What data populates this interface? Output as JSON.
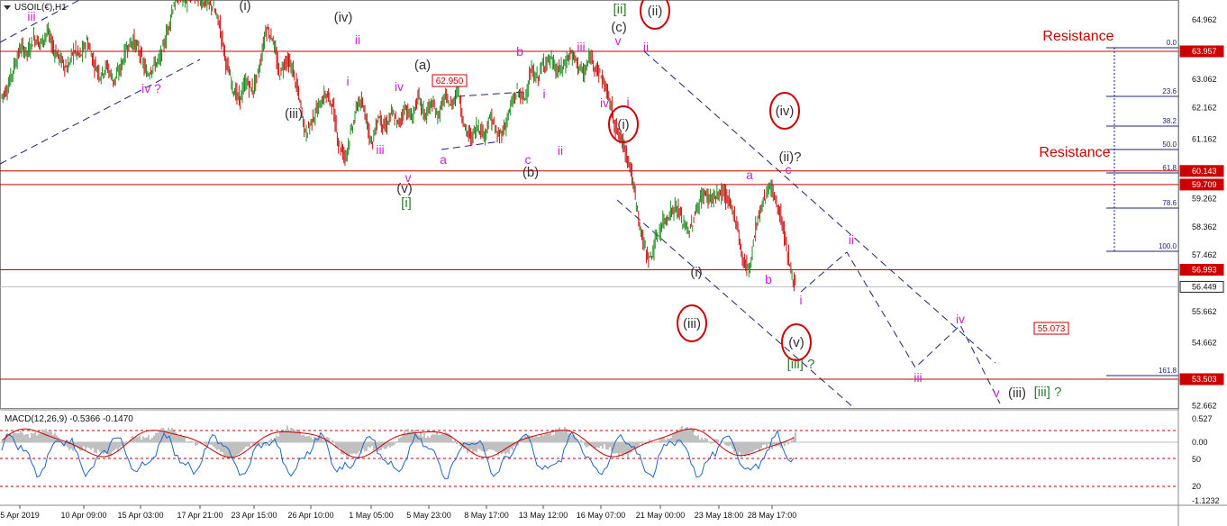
{
  "chart_data": [
    {
      "type": "line",
      "title": "USOIL(€),H1",
      "ylim": [
        52.3,
        65.6
      ],
      "y_ticks": [
        64.962,
        63.957,
        63.062,
        62.162,
        61.162,
        60.143,
        59.709,
        59.262,
        58.362,
        57.462,
        56.993,
        56.449,
        55.662,
        54.662,
        53.503,
        52.662
      ],
      "price_labels": [
        {
          "value": 63.957,
          "label": "63.957",
          "highlight": true
        },
        {
          "value": 60.143,
          "label": "60.143",
          "highlight": true
        },
        {
          "value": 59.709,
          "label": "59.709",
          "highlight": true
        },
        {
          "value": 56.993,
          "label": "56.993",
          "highlight": true
        },
        {
          "value": 53.503,
          "label": "53.503",
          "highlight": true
        },
        {
          "value": 56.449,
          "label": "56.449",
          "highlight": false
        }
      ],
      "tick_labels": [
        {
          "label": "64.962",
          "value": 64.962
        },
        {
          "label": "63.062",
          "value": 63.062
        },
        {
          "label": "62.162",
          "value": 62.162
        },
        {
          "label": "61.162",
          "value": 61.162
        },
        {
          "label": "59.262",
          "value": 59.262
        },
        {
          "label": "58.362",
          "value": 58.362
        },
        {
          "label": "57.462",
          "value": 57.462
        },
        {
          "label": "55.662",
          "value": 55.662
        },
        {
          "label": "54.662",
          "value": 54.662
        },
        {
          "label": "52.662",
          "value": 52.662
        }
      ],
      "horizontal_lines": [
        63.957,
        60.143,
        59.709,
        56.993,
        53.503
      ],
      "current_price": 56.449,
      "series": [
        {
          "values": [
            62.5,
            62.8,
            63.5,
            64.1,
            63.9,
            64.4,
            64.2,
            64.6,
            64.0,
            63.7,
            63.4,
            64.0,
            63.8,
            64.3,
            63.6,
            63.2,
            63.5,
            63.0,
            63.4,
            64.1,
            64.3,
            63.9,
            63.2,
            63.5,
            63.7,
            64.5,
            65.4,
            65.8,
            65.5,
            65.8,
            65.6,
            65.5,
            65.4,
            64.8,
            63.6,
            62.8,
            62.4,
            63.0,
            62.7,
            63.4,
            64.7,
            64.4,
            63.2,
            63.7,
            63.4,
            62.5,
            61.3,
            61.8,
            62.2,
            62.6,
            62.3,
            61.0,
            60.6,
            61.5,
            62.4,
            62.0,
            61.0,
            61.9,
            61.5,
            62.0,
            61.6,
            62.2,
            61.8,
            62.5,
            61.9,
            62.3,
            61.9,
            62.5,
            62.2,
            62.8,
            61.5,
            61.2,
            61.6,
            61.3,
            61.9,
            61.2,
            61.5,
            62.2,
            62.7,
            62.4,
            63.3,
            63.1,
            63.6,
            63.7,
            63.3,
            63.5,
            63.9,
            63.6,
            63.2,
            63.8,
            63.4,
            63.0,
            62.3,
            61.4,
            61.0,
            60.3,
            59.0,
            57.8,
            57.3,
            58.0,
            58.5,
            58.8,
            59.0,
            58.5,
            58.2,
            58.9,
            59.4,
            59.3,
            59.3,
            59.5,
            59.1,
            58.6,
            57.3,
            57.0,
            58.4,
            59.1,
            59.7,
            59.2,
            58.5,
            57.2,
            56.45
          ]
        }
      ],
      "labels_green": [
        {
          "text": "[ii]",
          "x": 688,
          "y": 15
        },
        {
          "text": "[i]",
          "x": 451,
          "y": 230
        },
        {
          "text": "[iii] ?",
          "x": 889,
          "y": 409
        },
        {
          "text": "[iii] ?",
          "x": 1163,
          "y": 440
        }
      ],
      "labels_dark": [
        {
          "text": "(i)",
          "x": 272,
          "y": 11
        },
        {
          "text": "(iv)",
          "x": 381,
          "y": 24
        },
        {
          "text": "(c)",
          "x": 687,
          "y": 35
        },
        {
          "text": "(a)",
          "x": 469,
          "y": 77
        },
        {
          "text": "(iii)",
          "x": 326,
          "y": 131
        },
        {
          "text": "(v)",
          "x": 449,
          "y": 214
        },
        {
          "text": "(b)",
          "x": 589,
          "y": 196
        },
        {
          "text": "(ii)?",
          "x": 877,
          "y": 179
        },
        {
          "text": "(i)",
          "x": 773,
          "y": 307
        },
        {
          "text": "(iii)",
          "x": 1129,
          "y": 441
        }
      ],
      "labels_circled": [
        {
          "text": "(ii)",
          "x": 727,
          "y": 17
        },
        {
          "text": "(iv)",
          "x": 871,
          "y": 128
        },
        {
          "text": "(i)",
          "x": 692,
          "y": 143
        },
        {
          "text": "(iii)",
          "x": 768,
          "y": 364
        },
        {
          "text": "(v)",
          "x": 884,
          "y": 385
        }
      ],
      "labels_magenta": [
        {
          "text": "iii",
          "x": 35,
          "y": 23
        },
        {
          "text": "iv ?",
          "x": 168,
          "y": 103
        },
        {
          "text": "ii",
          "x": 397,
          "y": 49
        },
        {
          "text": "i",
          "x": 386,
          "y": 95
        },
        {
          "text": "iv",
          "x": 443,
          "y": 101
        },
        {
          "text": "iii",
          "x": 422,
          "y": 171
        },
        {
          "text": "v",
          "x": 453,
          "y": 202
        },
        {
          "text": "a",
          "x": 492,
          "y": 182
        },
        {
          "text": "b",
          "x": 577,
          "y": 62
        },
        {
          "text": "i",
          "x": 604,
          "y": 109
        },
        {
          "text": "c",
          "x": 586,
          "y": 182
        },
        {
          "text": "ii",
          "x": 622,
          "y": 172
        },
        {
          "text": "iii",
          "x": 645,
          "y": 57
        },
        {
          "text": "v",
          "x": 686,
          "y": 50
        },
        {
          "text": "ii",
          "x": 717,
          "y": 57
        },
        {
          "text": "iv",
          "x": 671,
          "y": 119
        },
        {
          "text": "i",
          "x": 697,
          "y": 118
        },
        {
          "text": "a",
          "x": 832,
          "y": 199
        },
        {
          "text": "c",
          "x": 875,
          "y": 193
        },
        {
          "text": "b",
          "x": 853,
          "y": 315
        },
        {
          "text": "ii",
          "x": 945,
          "y": 271
        },
        {
          "text": "i",
          "x": 889,
          "y": 338
        },
        {
          "text": "iv",
          "x": 1066,
          "y": 359
        },
        {
          "text": "iii",
          "x": 1019,
          "y": 424
        },
        {
          "text": "v",
          "x": 1106,
          "y": 441
        }
      ],
      "box_labels": [
        {
          "text": "62.950",
          "x": 498,
          "y": 92
        },
        {
          "text": "55.073",
          "x": 1166,
          "y": 367
        }
      ],
      "resistance_labels": [
        {
          "text": "Resistance",
          "x": 1197,
          "y": 45
        },
        {
          "text": "Resistance",
          "x": 1193,
          "y": 174
        }
      ],
      "fib_levels": [
        {
          "label": "0.0",
          "y": 53
        },
        {
          "label": "23.6",
          "y": 107
        },
        {
          "label": "38.2",
          "y": 140
        },
        {
          "label": "50.0",
          "y": 166
        },
        {
          "label": "61.8",
          "y": 192
        },
        {
          "label": "78.6",
          "y": 231
        },
        {
          "label": "100.0",
          "y": 279
        },
        {
          "label": "161.8",
          "y": 417
        }
      ]
    },
    {
      "type": "line",
      "title": "MACD(12,26,9) -0.5366 -0.1470",
      "ylim": [
        -1.3,
        0.6
      ],
      "y_ticks": [
        0.527,
        0.0,
        50,
        20,
        -1.1232
      ],
      "tick_labels": [
        {
          "label": "0.527",
          "y": 465
        },
        {
          "label": "0.00",
          "y": 491
        },
        {
          "label": "50",
          "y": 510
        },
        {
          "label": "20",
          "y": 540
        },
        {
          "label": "-1.1232",
          "y": 556
        }
      ],
      "levels": [
        80,
        50,
        20
      ]
    }
  ],
  "x_axis": {
    "tick_labels": [
      "5 Apr 2019",
      "10 Apr 09:00",
      "15 Apr 03:00",
      "17 Apr 21:00",
      "23 Apr 15:00",
      "26 Apr 10:00",
      "1 May 05:00",
      "5 May 23:00",
      "8 May 17:00",
      "13 May 12:00",
      "16 May 07:00",
      "21 May 00:00",
      "23 May 18:00",
      "28 May 17:00"
    ]
  },
  "colors": {
    "magenta": "#cc22cc",
    "green": "#2e7d32",
    "dark": "#333333",
    "red": "#cc0000",
    "navy": "#1a237e",
    "up": "#228b22",
    "down": "#cc1111"
  },
  "header": {
    "indicator_icon": "triangle-down-icon"
  }
}
